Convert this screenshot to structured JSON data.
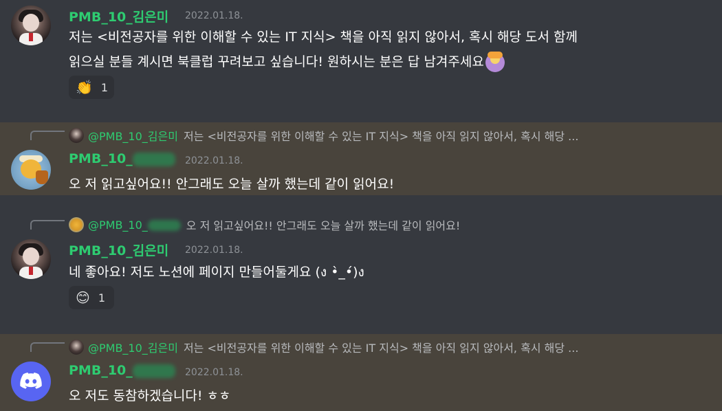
{
  "messages": [
    {
      "author": "PMB_10_김은미",
      "timestamp": "2022.01.18.",
      "lines": [
        "저는 <비전공자를 위한 이해할 수 있는 IT 지식> 책을 아직 읽지 않아서, 혹시 해당 도서 함께",
        "읽으실 분들 계시면 북클럽 꾸려보고 싶습니다! 원하시는 분은 답 남겨주세요"
      ],
      "reaction": {
        "emoji": "👏",
        "count": "1"
      }
    },
    {
      "reply": {
        "author": "@PMB_10_김은미",
        "text": "저는 <비전공자를 위한 이해할 수 있는 IT 지식> 책을 아직 읽지 않아서, 혹시 해당 ..."
      },
      "author": "PMB_10_",
      "timestamp": "2022.01.18.",
      "lines": [
        "오 저 읽고싶어요!! 안그래도 오늘 살까 했는데 같이 읽어요!"
      ]
    },
    {
      "reply": {
        "author": "@PMB_10_",
        "text": "오 저 읽고싶어요!! 안그래도 오늘 살까 했는데 같이 읽어요!"
      },
      "author": "PMB_10_김은미",
      "timestamp": "2022.01.18.",
      "lines": [
        "네 좋아요! 저도 노션에 페이지 만들어둘게요 (ง •̀_•́)ง"
      ],
      "reaction": {
        "emoji": "😊",
        "count": "1"
      }
    },
    {
      "reply": {
        "author": "@PMB_10_김은미",
        "text": "저는 <비전공자를 위한 이해할 수 있는 IT 지식> 책을 아직 읽지 않아서, 혹시 해당 ..."
      },
      "author": "PMB_10_",
      "timestamp": "2022.01.18.",
      "lines": [
        "오 저도 동참하겠습니다! ㅎㅎ"
      ]
    }
  ],
  "colors": {
    "background": "#36393f",
    "highlight": "#49443c",
    "username": "#2ecc71",
    "timestamp": "#8e9297",
    "reaction_bg": "#2f3136",
    "discord_blurple": "#5865f2"
  },
  "icons": {
    "emoji_person": "person-gesturing-ok-icon",
    "discord": "discord-logo-icon"
  }
}
